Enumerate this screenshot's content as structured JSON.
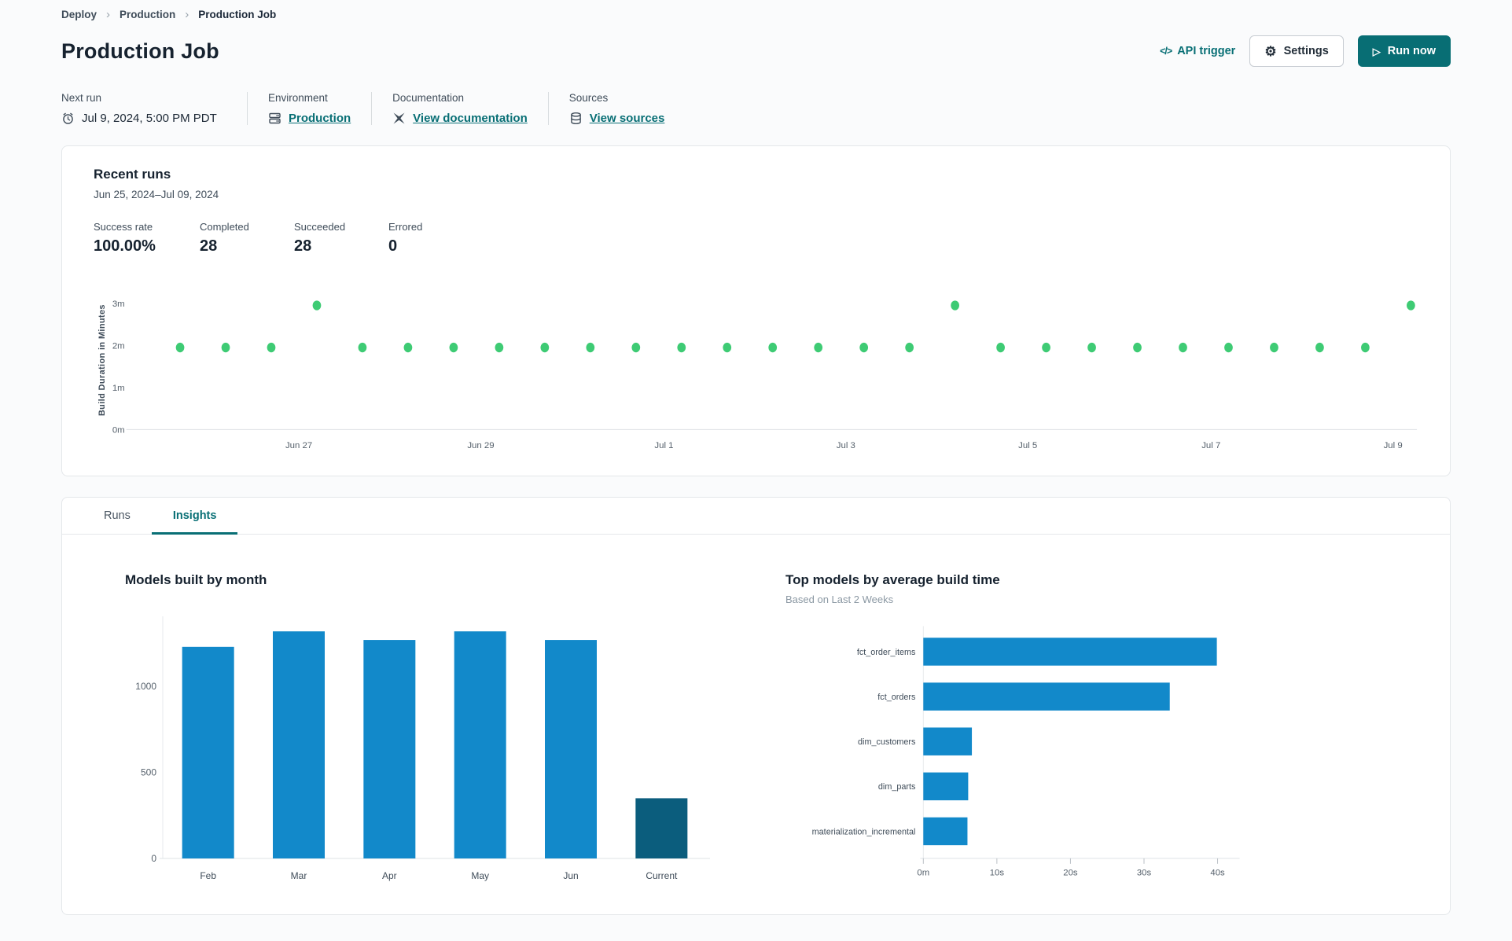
{
  "breadcrumb": {
    "items": [
      "Deploy",
      "Production",
      "Production Job"
    ]
  },
  "header": {
    "title": "Production Job",
    "api_trigger_label": "API trigger",
    "settings_label": "Settings",
    "run_now_label": "Run now"
  },
  "info": {
    "next_run": {
      "label": "Next run",
      "value": "Jul 9, 2024, 5:00 PM PDT"
    },
    "environment": {
      "label": "Environment",
      "value": "Production"
    },
    "documentation": {
      "label": "Documentation",
      "value": "View documentation"
    },
    "sources": {
      "label": "Sources",
      "value": "View sources"
    }
  },
  "recent_runs": {
    "title": "Recent runs",
    "date_range": "Jun 25, 2024–Jul 09, 2024",
    "stats": [
      {
        "label": "Success rate",
        "value": "100.00%"
      },
      {
        "label": "Completed",
        "value": "28"
      },
      {
        "label": "Succeeded",
        "value": "28"
      },
      {
        "label": "Errored",
        "value": "0"
      }
    ]
  },
  "tabs": [
    {
      "label": "Runs",
      "active": false
    },
    {
      "label": "Insights",
      "active": true
    }
  ],
  "colors": {
    "teal": "#086e74",
    "green_dot": "#3ecb74",
    "bar_blue": "#1289ca",
    "bar_dark": "#0b5d7d",
    "axis_line": "#dfe3e6",
    "tick_text": "#55606b",
    "label_text": "#3f4c59"
  },
  "chart_data": [
    {
      "type": "scatter",
      "title": "Recent runs build duration",
      "ylabel": "Build Duration in Minutes",
      "y_ticks": [
        {
          "label": "0m",
          "value": 0
        },
        {
          "label": "1m",
          "value": 1
        },
        {
          "label": "2m",
          "value": 2
        },
        {
          "label": "3m",
          "value": 3
        }
      ],
      "ylim": [
        0,
        3.3
      ],
      "x_ticks": [
        "Jun 27",
        "Jun 29",
        "Jul 1",
        "Jul 3",
        "Jul 5",
        "Jul 7",
        "Jul 9"
      ],
      "x_tick_fractions": [
        0.131,
        0.273,
        0.416,
        0.558,
        0.7,
        0.843,
        0.985
      ],
      "points_note": "28 runs Jun 25 – Jul 9, two per day, duration in minutes",
      "first_point_fraction": 0.0383,
      "point_spacing_fraction": 0.03558,
      "durations_minutes": [
        1.95,
        1.95,
        1.95,
        2.95,
        1.95,
        1.95,
        1.95,
        1.95,
        1.95,
        1.95,
        1.95,
        1.95,
        1.95,
        1.95,
        1.95,
        1.95,
        1.95,
        2.95,
        1.95,
        1.95,
        1.95,
        1.95,
        1.95,
        1.95,
        1.95,
        1.95,
        1.95,
        2.95
      ],
      "point_color": "#3ecb74",
      "grid": false
    },
    {
      "type": "bar",
      "title": "Models built by month",
      "categories": [
        "Feb",
        "Mar",
        "Apr",
        "May",
        "Jun",
        "Current"
      ],
      "values": [
        1230,
        1320,
        1270,
        1320,
        1270,
        350
      ],
      "y_ticks": [
        0,
        500,
        1000
      ],
      "ylim": [
        0,
        1380
      ],
      "xlabel": "",
      "ylabel": "",
      "bar_color": "#1289ca",
      "last_bar_color": "#0b5d7d",
      "grid": false
    },
    {
      "type": "bar-horizontal",
      "title": "Top models by average build time",
      "subtitle": "Based on Last 2 Weeks",
      "categories": [
        "fct_order_items",
        "fct_orders",
        "dim_customers",
        "dim_parts",
        "materialization_incremental"
      ],
      "values_seconds": [
        39.9,
        33.5,
        6.6,
        6.1,
        6.0
      ],
      "x_ticks": [
        {
          "label": "0m",
          "value": 0
        },
        {
          "label": "10s",
          "value": 10
        },
        {
          "label": "20s",
          "value": 20
        },
        {
          "label": "30s",
          "value": 30
        },
        {
          "label": "40s",
          "value": 40
        }
      ],
      "xlim": [
        0,
        43
      ],
      "bar_color": "#1289ca",
      "grid": false
    }
  ]
}
